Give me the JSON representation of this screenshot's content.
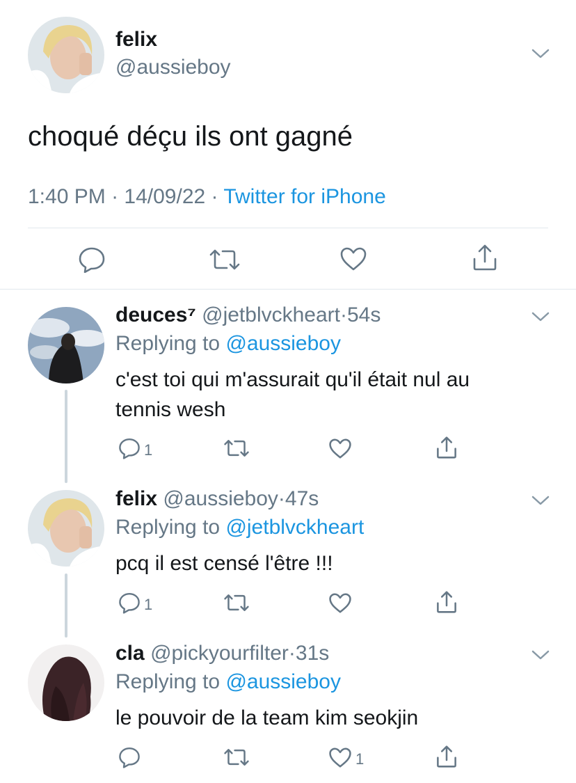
{
  "main_tweet": {
    "display_name": "felix",
    "handle": "@aussieboy",
    "text": "choqué déçu ils ont gagné",
    "time": "1:40 PM",
    "date": "14/09/22",
    "source": "Twitter for iPhone",
    "separator": "·"
  },
  "replies": [
    {
      "display_name": "deuces⁷",
      "handle": "@jetblvckheart",
      "age": "54s",
      "replying_label": "Replying to",
      "replying_to": "@aussieboy",
      "text_line1": "c'est toi qui m'assurait qu'il était nul au",
      "text_line2": "tennis wesh",
      "reply_count": "1",
      "like_count": ""
    },
    {
      "display_name": "felix",
      "handle": "@aussieboy",
      "age": "47s",
      "replying_label": "Replying to",
      "replying_to": "@jetblvckheart",
      "text_line1": "pcq il est censé l'être !!!",
      "reply_count": "1",
      "like_count": ""
    },
    {
      "display_name": "cla",
      "handle": "@pickyourfilter",
      "age": "31s",
      "replying_label": "Replying to",
      "replying_to": "@aussieboy",
      "text_line1": "le pouvoir de la team kim seokjin",
      "reply_count": "",
      "like_count": "1"
    }
  ],
  "dot": "·",
  "icons": {
    "reply": "reply-bubble-icon",
    "retweet": "retweet-icon",
    "like": "heart-icon",
    "share": "share-icon",
    "menu": "chevron-down-icon"
  },
  "colors": {
    "link_blue": "#1b95e0",
    "secondary_grey": "#657786",
    "divider": "#e1e8ed"
  }
}
